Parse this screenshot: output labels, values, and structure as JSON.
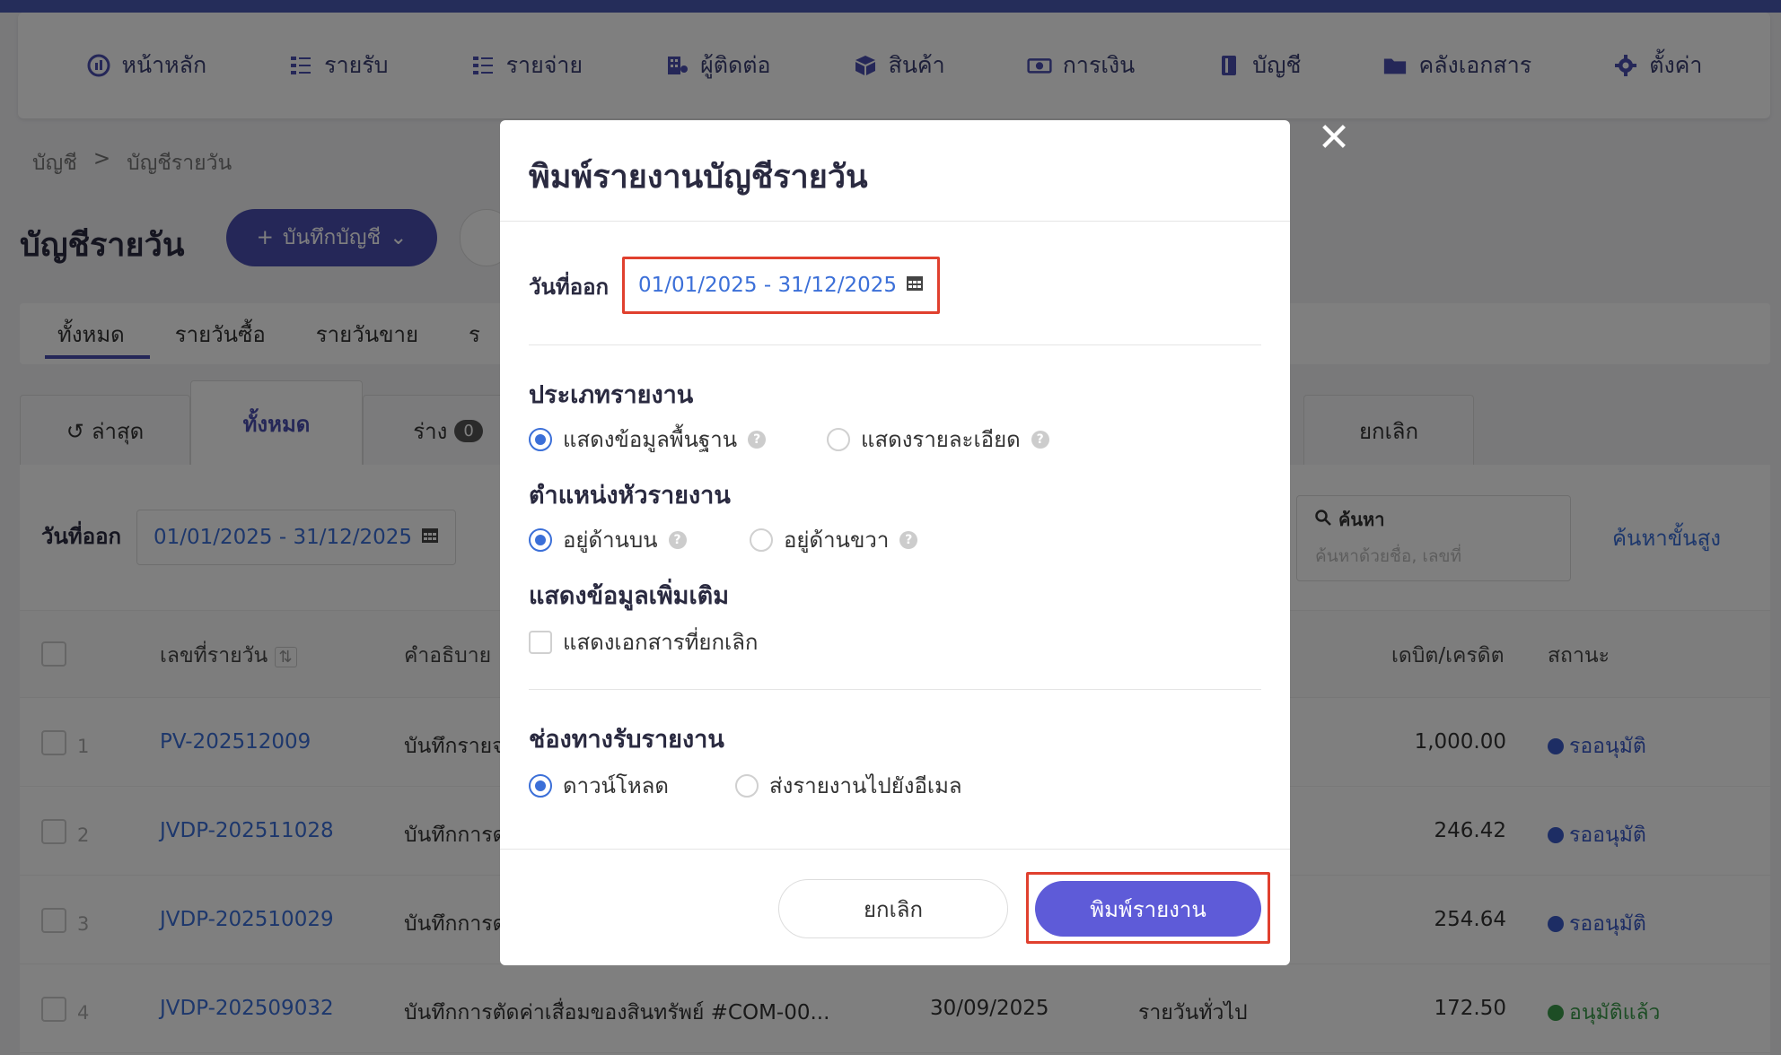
{
  "nav": {
    "items": [
      {
        "label": "หน้าหลัก",
        "icon": "dashboard-icon"
      },
      {
        "label": "รายรับ",
        "icon": "income-list-icon"
      },
      {
        "label": "รายจ่าย",
        "icon": "expense-list-icon"
      },
      {
        "label": "ผู้ติดต่อ",
        "icon": "contacts-building-icon"
      },
      {
        "label": "สินค้า",
        "icon": "product-box-icon"
      },
      {
        "label": "การเงิน",
        "icon": "money-icon"
      },
      {
        "label": "บัญชี",
        "icon": "ledger-book-icon"
      },
      {
        "label": "คลังเอกสาร",
        "icon": "folder-icon"
      },
      {
        "label": "ตั้งค่า",
        "icon": "gear-icon"
      }
    ]
  },
  "breadcrumb": {
    "root": "บัญชี",
    "separator": ">",
    "current": "บัญชีรายวัน"
  },
  "page": {
    "title": "บัญชีรายวัน",
    "add_button": "บันทึกบัญชี"
  },
  "type_tabs": [
    "ทั้งหมด",
    "รายวันซื้อ",
    "รายวันขาย",
    "ร"
  ],
  "status_tabs": {
    "latest": "ล่าสุด",
    "all": "ทั้งหมด",
    "draft": "ร่าง",
    "draft_count": "0",
    "cancelled": "ยกเลิก"
  },
  "filter": {
    "date_label": "วันที่ออก",
    "date_range": "01/01/2025 - 31/12/2025",
    "search_title": "ค้นหา",
    "search_placeholder": "ค้นหาด้วยชื่อ, เลขที่",
    "advanced_search": "ค้นหาขั้นสูง"
  },
  "table": {
    "headers": {
      "number": "เลขที่รายวัน",
      "description": "คำอธิบาย",
      "amount": "เดบิต/เครดิต",
      "status": "สถานะ"
    },
    "rows": [
      {
        "index": "1",
        "number": "PV-202512009",
        "description": "บันทึกรายจ",
        "date": "",
        "type": "",
        "amount": "1,000.00",
        "status": "รออนุมัติ",
        "status_color": "#3b5bc8"
      },
      {
        "index": "2",
        "number": "JVDP-202511028",
        "description": "บันทึกการด",
        "date": "",
        "type": "",
        "amount": "246.42",
        "status": "รออนุมัติ",
        "status_color": "#3b5bc8"
      },
      {
        "index": "3",
        "number": "JVDP-202510029",
        "description": "บันทึกการด",
        "date": "",
        "type": "",
        "amount": "254.64",
        "status": "รออนุมัติ",
        "status_color": "#3b5bc8"
      },
      {
        "index": "4",
        "number": "JVDP-202509032",
        "description": "บันทึกการตัดค่าเสื่อมของสินทรัพย์ #COM-00...",
        "date": "30/09/2025",
        "type": "รายวันทั่วไป",
        "amount": "172.50",
        "status": "อนุมัติแล้ว",
        "status_color": "#3a9a4a"
      }
    ]
  },
  "modal": {
    "title": "พิมพ์รายงานบัญชีรายวัน",
    "close_symbol": "✕",
    "date_label": "วันที่ออก",
    "date_range": "01/01/2025 - 31/12/2025",
    "report_type_title": "ประเภทรายงาน",
    "report_type_basic": "แสดงข้อมูลพื้นฐาน",
    "report_type_detail": "แสดงรายละเอียด",
    "header_pos_title": "ตำแหน่งหัวรายงาน",
    "header_pos_top": "อยู่ด้านบน",
    "header_pos_right": "อยู่ด้านขวา",
    "extra_title": "แสดงข้อมูลเพิ่มเติม",
    "extra_show_cancelled": "แสดงเอกสารที่ยกเลิก",
    "channel_title": "ช่องทางรับรายงาน",
    "channel_download": "ดาวน์โหลด",
    "channel_email": "ส่งรายงานไปยังอีเมล",
    "cancel_button": "ยกเลิก",
    "print_button": "พิมพ์รายงาน"
  },
  "colors": {
    "brand": "#4b4fb0",
    "link": "#3b6fd8",
    "highlight": "#e0402e",
    "primary_button": "#5e5bd8"
  }
}
